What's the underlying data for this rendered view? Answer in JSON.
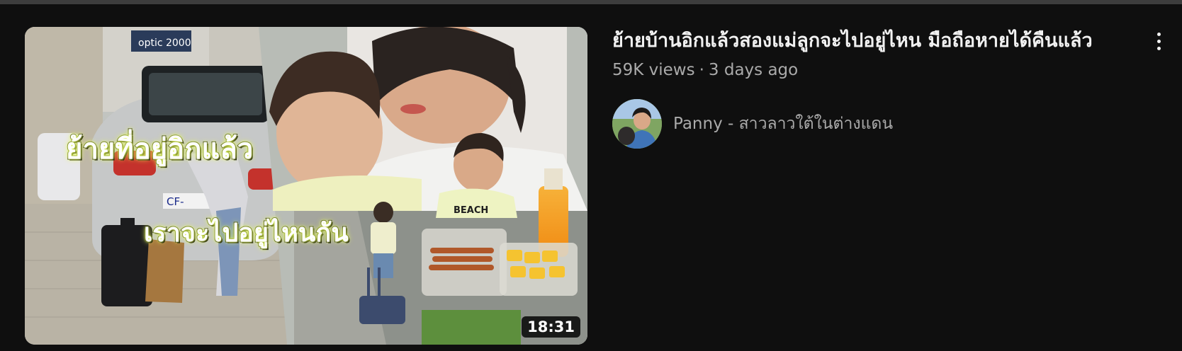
{
  "video": {
    "title": "ย้ายบ้านอิกแล้วสองแม่ลูกจะไปอยู่ไหน มือถือหายได้คืนแล้ว",
    "views": "59K views",
    "separator": "·",
    "uploaded": "3 days ago",
    "duration": "18:31",
    "thumbnail_text_1": "ย้ายที่อยู่อิกแล้ว",
    "thumbnail_text_2": "เราจะไปอยู่ไหนกัน",
    "thumbnail_sign": "optic 2000",
    "thumbnail_plate": "CF-",
    "thumbnail_shirt": "BEACH"
  },
  "channel": {
    "name": "Panny - สาวลาวใต้ในต่างแดน"
  },
  "icons": {
    "more": "more-vertical-icon"
  }
}
